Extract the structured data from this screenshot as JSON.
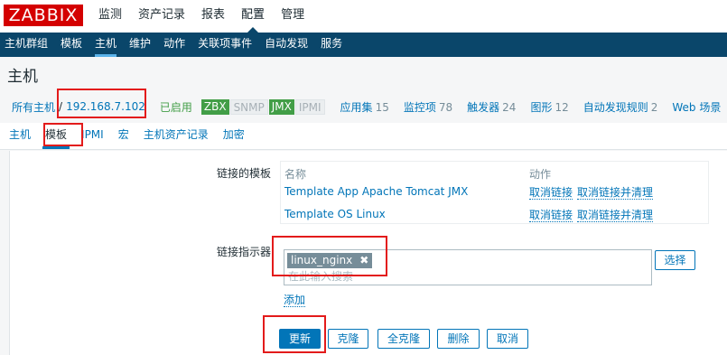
{
  "logo": "ZABBIX",
  "main_menu": [
    "监测",
    "资产记录",
    "报表",
    "配置",
    "管理"
  ],
  "sub_menu": [
    "主机群组",
    "模板",
    "主机",
    "维护",
    "动作",
    "关联项事件",
    "自动发现",
    "服务"
  ],
  "page_title": "主机",
  "breadcrumb": {
    "all_hosts": "所有主机",
    "separator": "/",
    "host": "192.168.7.102",
    "status": "已启用"
  },
  "availability": {
    "zbx": "ZBX",
    "snmp": "SNMP",
    "jmx": "JMX",
    "ipmi": "IPMI"
  },
  "stats": {
    "applications": {
      "label": "应用集",
      "count": "15"
    },
    "items": {
      "label": "监控项",
      "count": "78"
    },
    "triggers": {
      "label": "触发器",
      "count": "24"
    },
    "graphs": {
      "label": "图形",
      "count": "12"
    },
    "discovery": {
      "label": "自动发现规则",
      "count": "2"
    },
    "web": {
      "label": "Web 场景"
    }
  },
  "tabs": [
    "主机",
    "模板",
    "IPMI",
    "宏",
    "主机资产记录",
    "加密"
  ],
  "form": {
    "linked_templates_label": "链接的模板",
    "col_name": "名称",
    "col_action": "动作",
    "templates": [
      {
        "name": "Template App Apache Tomcat JMX",
        "unlink": "取消链接",
        "unlink_clear": "取消链接并清理"
      },
      {
        "name": "Template OS Linux",
        "unlink": "取消链接",
        "unlink_clear": "取消链接并清理"
      }
    ],
    "link_new_label": "链接指示器",
    "selected_chip": "linux_nginx",
    "chip_remove": "✖",
    "search_placeholder": "在此输入搜索",
    "select_button": "选择",
    "add_link": "添加"
  },
  "buttons": {
    "update": "更新",
    "clone": "克隆",
    "full_clone": "全克隆",
    "delete": "删除",
    "cancel": "取消"
  },
  "colors": {
    "brand": "#d40000",
    "nav": "#0a466a",
    "link": "#0275b8",
    "enabled": "#429e47",
    "highlight": "#e31b1b"
  }
}
